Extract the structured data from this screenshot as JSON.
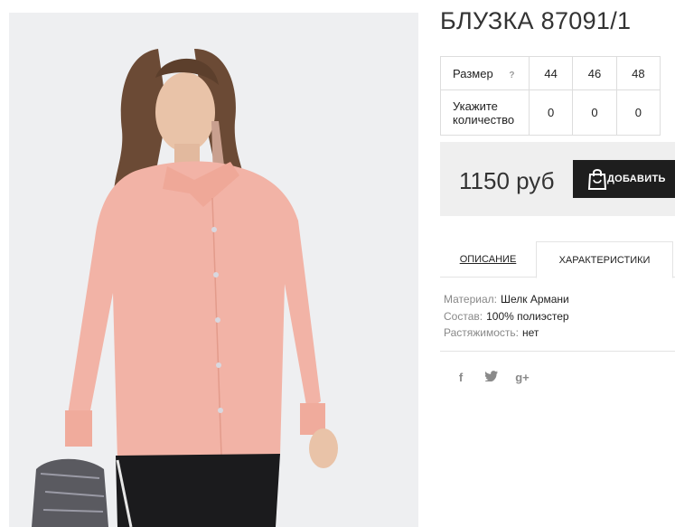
{
  "product": {
    "title": "БЛУЗКА 87091/1",
    "image_alt": "blouse-photo"
  },
  "size_table": {
    "size_label": "Размер",
    "help_glyph": "?",
    "sizes": [
      "44",
      "46",
      "48"
    ],
    "qty_label": "Укажите количество",
    "quantities": [
      "0",
      "0",
      "0"
    ]
  },
  "purchase": {
    "price": "1150 руб",
    "add_to_cart_label": "ДОБАВИТЬ"
  },
  "tabs": {
    "description": "ОПИСАНИЕ",
    "characteristics": "ХАРАКТЕРИСТИКИ",
    "active": "characteristics"
  },
  "characteristics": [
    {
      "key": "Материал:",
      "value": "Шелк Армани"
    },
    {
      "key": "Состав:",
      "value": "100% полиэстер"
    },
    {
      "key": "Растяжимость:",
      "value": "нет"
    }
  ],
  "social": {
    "facebook": "f",
    "twitter": "𝕥",
    "google_plus": "g+"
  },
  "colors": {
    "button_bg": "#1e1e1e",
    "price_bg": "#efefef",
    "photo_bg": "#eeeff1",
    "blouse": "#f2b3a6"
  }
}
